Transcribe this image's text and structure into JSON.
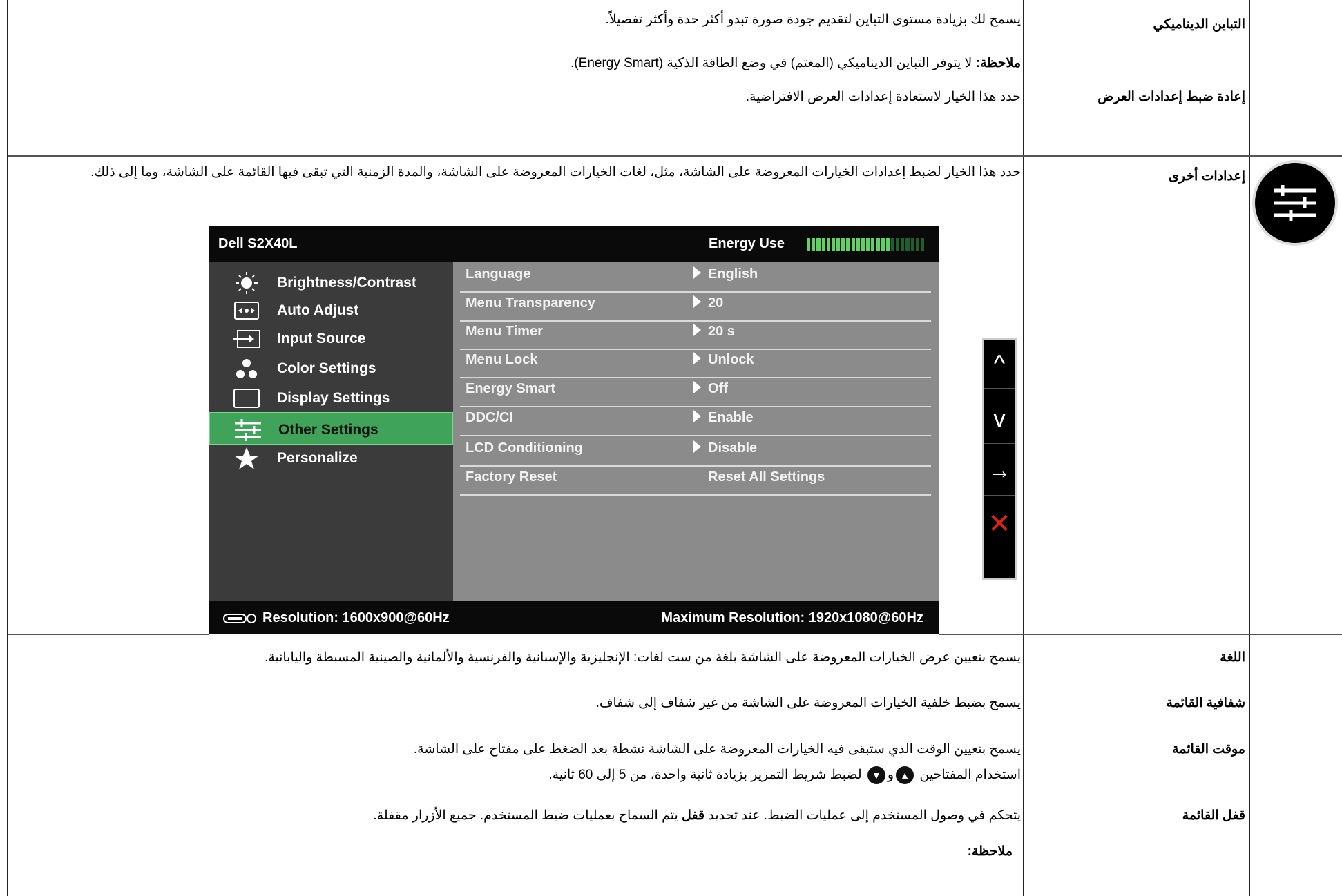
{
  "rows": {
    "dynamic_contrast": {
      "label": "التباين الديناميكي",
      "text1": "يسمح لك بزيادة مستوى التباين لتقديم جودة صورة تبدو أكثر حدة وأكثر تفصيلاً.",
      "note_prefix": "ملاحظة:",
      "note": " لا يتوفر التباين الديناميكي (المعتم) في وضع الطاقة الذكية (Energy Smart)."
    },
    "reset_display": {
      "label": "إعادة ضبط إعدادات العرض",
      "text": "حدد هذا الخيار لاستعادة إعدادات العرض الافتراضية."
    },
    "other_settings": {
      "label": "إعدادات أخرى",
      "text": "حدد هذا الخيار لضبط إعدادات الخيارات المعروضة على الشاشة، مثل، لغات الخيارات المعروضة على الشاشة، والمدة الزمنية التي تبقى فيها القائمة على الشاشة، وما إلى ذلك."
    },
    "language": {
      "label": "اللغة",
      "text": "يسمح بتعيين عرض الخيارات المعروضة على الشاشة بلغة من ست لغات: الإنجليزية والإسبانية والفرنسية والألمانية والصينية المسبطة واليابانية."
    },
    "menu_transparency": {
      "label": "شفافية القائمة",
      "text": "يسمح بضبط خلفية الخيارات المعروضة على الشاشة من غير شفاف إلى شفاف."
    },
    "menu_timer": {
      "label": "موقت القائمة",
      "text1": "يسمح بتعيين الوقت الذي ستبقى فيه الخيارات المعروضة على الشاشة نشطة بعد الضغط على مفتاح على الشاشة.",
      "text2a": "استخدام المفتاحين",
      "text2b": "و",
      "text2c": "لضبط شريط التمرير بزيادة ثانية واحدة، من 5 إلى 60 ثانية."
    },
    "menu_lock": {
      "label": "قفل القائمة",
      "text_a": "يتحكم في وصول المستخدم إلى عمليات الضبط. عند تحديد ",
      "text_bold": "قفل",
      "text_b": " يتم السماح بعمليات ضبط المستخدم. جميع الأزرار مقفلة.",
      "note": "ملاحظة:"
    }
  },
  "osd": {
    "model": "Dell S2X40L",
    "energy_label": "Energy Use",
    "energy_level": 0.72,
    "menu": [
      {
        "label": "Brightness/Contrast",
        "icon": "sun-icon"
      },
      {
        "label": "Auto Adjust",
        "icon": "auto-adjust-icon"
      },
      {
        "label": "Input Source",
        "icon": "input-source-icon"
      },
      {
        "label": "Color Settings",
        "icon": "color-dots-icon"
      },
      {
        "label": "Display Settings",
        "icon": "display-rect-icon"
      },
      {
        "label": "Other Settings",
        "icon": "sliders-icon",
        "selected": true
      },
      {
        "label": "Personalize",
        "icon": "star-icon"
      }
    ],
    "settings": [
      {
        "name": "Language",
        "value": "English",
        "arrow": true
      },
      {
        "name": "Menu Transparency",
        "value": "20",
        "arrow": true
      },
      {
        "name": "Menu Timer",
        "value": "20 s",
        "arrow": true
      },
      {
        "name": "Menu Lock",
        "value": "Unlock",
        "arrow": true
      },
      {
        "name": "Energy Smart",
        "value": "Off",
        "arrow": true
      },
      {
        "name": "DDC/CI",
        "value": "Enable",
        "arrow": true
      },
      {
        "name": "LCD Conditioning",
        "value": "Disable",
        "arrow": true
      },
      {
        "name": "Factory Reset",
        "value": "Reset All Settings",
        "arrow": false
      }
    ],
    "resolution": "Resolution: 1600x900@60Hz",
    "max_resolution": "Maximum Resolution: 1920x1080@60Hz",
    "colors": {
      "selected": "#3fa35a",
      "meter_on": "#5fd35f",
      "meter_off": "#1f5f2f"
    }
  },
  "buttons": {
    "up": "^",
    "down": "v",
    "right": "→",
    "close": "✕",
    "close_color": "#e02020"
  }
}
